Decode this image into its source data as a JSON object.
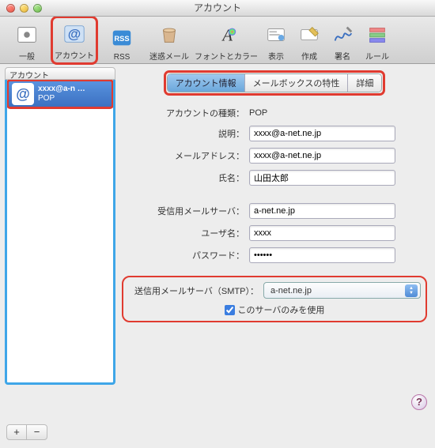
{
  "window": {
    "title": "アカウント"
  },
  "toolbar": {
    "items": [
      {
        "label": "一般"
      },
      {
        "label": "アカウント"
      },
      {
        "label": "RSS"
      },
      {
        "label": "迷惑メール"
      },
      {
        "label": "フォントとカラー"
      },
      {
        "label": "表示"
      },
      {
        "label": "作成"
      },
      {
        "label": "署名"
      },
      {
        "label": "ルール"
      }
    ]
  },
  "sidebar": {
    "header": "アカウント",
    "account": {
      "title": "xxxx@a-n …",
      "subtitle": "POP"
    }
  },
  "tabs": {
    "items": [
      "アカウント情報",
      "メールボックスの特性",
      "詳細"
    ],
    "selected": 0
  },
  "form": {
    "type_label": "アカウントの種類：",
    "type_value": "POP",
    "desc_label": "説明：",
    "desc_value": "xxxx@a-net.ne.jp",
    "mail_label": "メールアドレス：",
    "mail_value": "xxxx@a-net.ne.jp",
    "name_label": "氏名：",
    "name_value": "山田太郎",
    "in_server_label": "受信用メールサーバ：",
    "in_server_value": "a-net.ne.jp",
    "user_label": "ユーザ名：",
    "user_value": "xxxx",
    "pass_label": "パスワード：",
    "pass_value": "••••••",
    "smtp_label": "送信用メールサーバ（SMTP）：",
    "smtp_value": "a-net.ne.jp",
    "only_server_label": "このサーバのみを使用",
    "only_server_checked": true
  },
  "buttons": {
    "add": "+",
    "remove": "−",
    "help": "?"
  }
}
